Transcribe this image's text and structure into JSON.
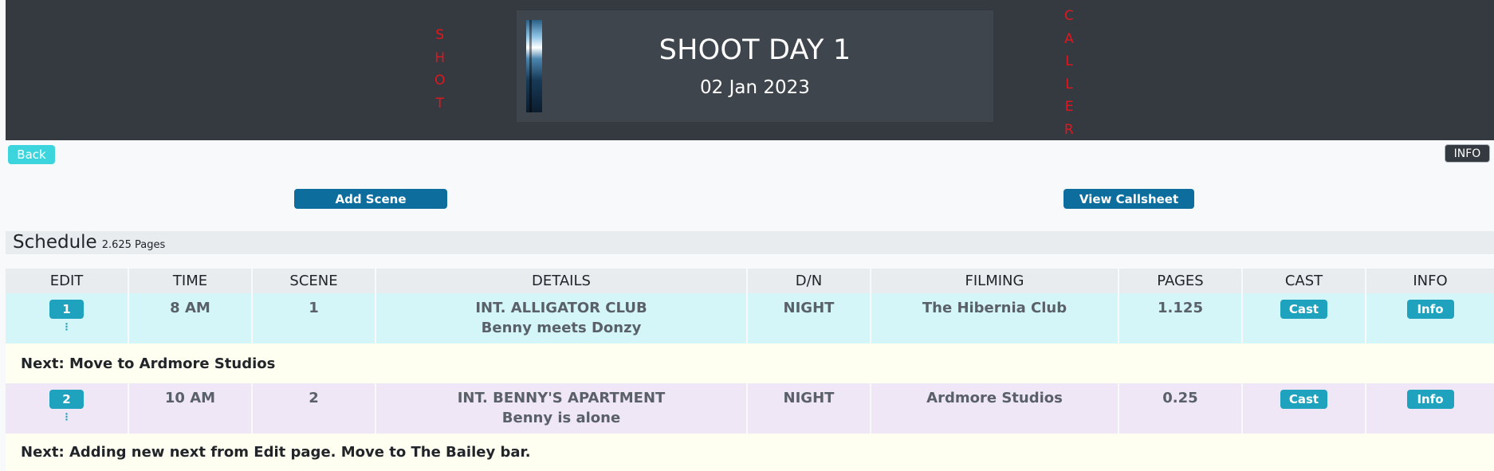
{
  "header": {
    "left_word": [
      "S",
      "H",
      "O",
      "T"
    ],
    "right_word": [
      "C",
      "A",
      "L",
      "L",
      "E",
      "R"
    ],
    "day_title": "SHOOT DAY 1",
    "day_date": "02 Jan 2023"
  },
  "toolbar": {
    "back_label": "Back",
    "info_label": "INFO",
    "add_scene_label": "Add Scene",
    "view_callsheet_label": "View Callsheet"
  },
  "schedule": {
    "title": "Schedule",
    "pages": "2.625 Pages"
  },
  "table": {
    "columns": [
      "EDIT",
      "TIME",
      "SCENE",
      "DETAILS",
      "D/N",
      "FILMING",
      "PAGES",
      "CAST",
      "INFO"
    ],
    "rows": [
      {
        "edit": "1",
        "time": "8 AM",
        "scene": "1",
        "details_1": "INT. ALLIGATOR CLUB",
        "details_2": "Benny meets Donzy",
        "dn": "NIGHT",
        "filming": "The Hibernia Club",
        "pages": "1.125",
        "cast_label": "Cast",
        "info_label": "Info",
        "next": "Next: Move to Ardmore Studios"
      },
      {
        "edit": "2",
        "time": "10 AM",
        "scene": "2",
        "details_1": "INT. BENNY'S APARTMENT",
        "details_2": "Benny is alone",
        "dn": "NIGHT",
        "filming": "Ardmore Studios",
        "pages": "0.25",
        "cast_label": "Cast",
        "info_label": "Info",
        "next": "Next: Adding new next from Edit page. Move to The Bailey bar."
      }
    ]
  },
  "colors": {
    "header_bg": "#343a40",
    "accent_red": "#e3161e",
    "teal": "#1fa2bd",
    "primary": "#0d6e9e"
  }
}
